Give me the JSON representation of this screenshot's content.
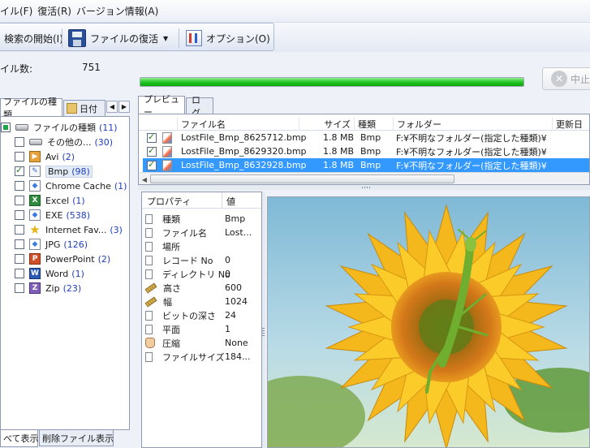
{
  "menu": {
    "file": "イル(F)",
    "recover": "復活(R)",
    "version": "バージョン情報(A)"
  },
  "toolbar": {
    "search_start": "検索の開始(I)",
    "file_recover": "ファイルの復活",
    "options": "オプション(O)"
  },
  "status": {
    "file_count_label": "イル数:",
    "file_count": "751",
    "progress_fraction": 1.0,
    "stop_label": "中止"
  },
  "left_tabs": {
    "file_type": "ファイルの種類",
    "date": "日付"
  },
  "tree": {
    "root": {
      "label": "ファイルの種類",
      "count": "(11)"
    },
    "items": [
      {
        "label": "その他の...",
        "count": "(30)",
        "icon": "drive-icon"
      },
      {
        "label": "Avi",
        "count": "(2)",
        "icon": "avi-icon"
      },
      {
        "label": "Bmp",
        "count": "(98)",
        "icon": "bmp-icon"
      },
      {
        "label": "Chrome Cache",
        "count": "(1)",
        "icon": "chrome-icon"
      },
      {
        "label": "Excel",
        "count": "(1)",
        "icon": "excel-icon"
      },
      {
        "label": "EXE",
        "count": "(538)",
        "icon": "exe-icon"
      },
      {
        "label": "Internet Fav...",
        "count": "(3)",
        "icon": "star-icon"
      },
      {
        "label": "JPG",
        "count": "(126)",
        "icon": "jpg-icon"
      },
      {
        "label": "PowerPoint",
        "count": "(2)",
        "icon": "powerpoint-icon"
      },
      {
        "label": "Word",
        "count": "(1)",
        "icon": "word-icon"
      },
      {
        "label": "Zip",
        "count": "(23)",
        "icon": "zip-icon"
      }
    ]
  },
  "bottom_tabs": {
    "show_all": "べて表示",
    "show_deleted": "削除ファイル表示"
  },
  "right_tabs": {
    "preview": "プレビュー",
    "log": "ログ"
  },
  "file_list": {
    "columns": [
      "ファイル名",
      "サイズ",
      "種類",
      "フォルダー",
      "更新日"
    ],
    "rows": [
      {
        "name": "LostFile_Bmp_8625712.bmp",
        "size": "1.8 MB",
        "type": "Bmp",
        "folder": "F:¥不明なフォルダー(指定した種類)¥"
      },
      {
        "name": "LostFile_Bmp_8629320.bmp",
        "size": "1.8 MB",
        "type": "Bmp",
        "folder": "F:¥不明なフォルダー(指定した種類)¥"
      },
      {
        "name": "LostFile_Bmp_8632928.bmp",
        "size": "1.8 MB",
        "type": "Bmp",
        "folder": "F:¥不明なフォルダー(指定した種類)¥"
      }
    ]
  },
  "properties": {
    "header_name": "プロパティ",
    "header_value": "値",
    "rows": [
      {
        "name": "種類",
        "value": "Bmp"
      },
      {
        "name": "ファイル名",
        "value": "Lost..."
      },
      {
        "name": "場所",
        "value": ""
      },
      {
        "name": "レコード No",
        "value": "0"
      },
      {
        "name": "ディレクトリ No",
        "value": "0"
      },
      {
        "name": "高さ",
        "value": "600"
      },
      {
        "name": "幅",
        "value": "1024"
      },
      {
        "name": "ビットの深さ",
        "value": "24"
      },
      {
        "name": "平面",
        "value": "1"
      },
      {
        "name": "圧縮",
        "value": "None"
      },
      {
        "name": "ファイルサイズ",
        "value": "184..."
      }
    ]
  },
  "colors": {
    "selection": "#3399ff",
    "progress": "#1fc41f",
    "count_blue": "#1f3fbf"
  }
}
